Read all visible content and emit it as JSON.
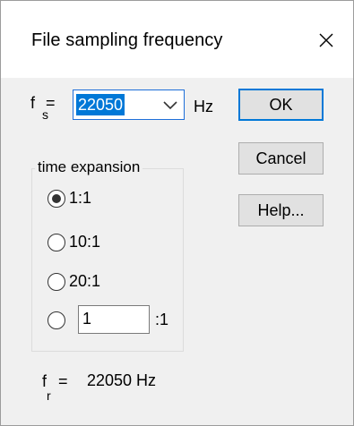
{
  "window": {
    "title": "File sampling frequency",
    "close_icon": "close-icon"
  },
  "fs": {
    "label_main": "f",
    "label_sub": "s",
    "equals": "=",
    "value": "22050",
    "unit": "Hz",
    "dropdown_icon": "chevron-down-icon"
  },
  "buttons": {
    "ok": "OK",
    "cancel": "Cancel",
    "help": "Help..."
  },
  "time_expansion": {
    "legend": "time expansion",
    "options": [
      {
        "label": "1:1",
        "checked": true
      },
      {
        "label": "10:1",
        "checked": false
      },
      {
        "label": "20:1",
        "checked": false
      }
    ],
    "custom_value": "1",
    "custom_suffix": ":1"
  },
  "fr": {
    "label_main": "f",
    "label_sub": "r",
    "equals": "=",
    "value_text": "22050 Hz"
  },
  "colors": {
    "accent": "#0078d7",
    "dialog_bg": "#f0f0f0",
    "titlebar_bg": "#ffffff"
  }
}
